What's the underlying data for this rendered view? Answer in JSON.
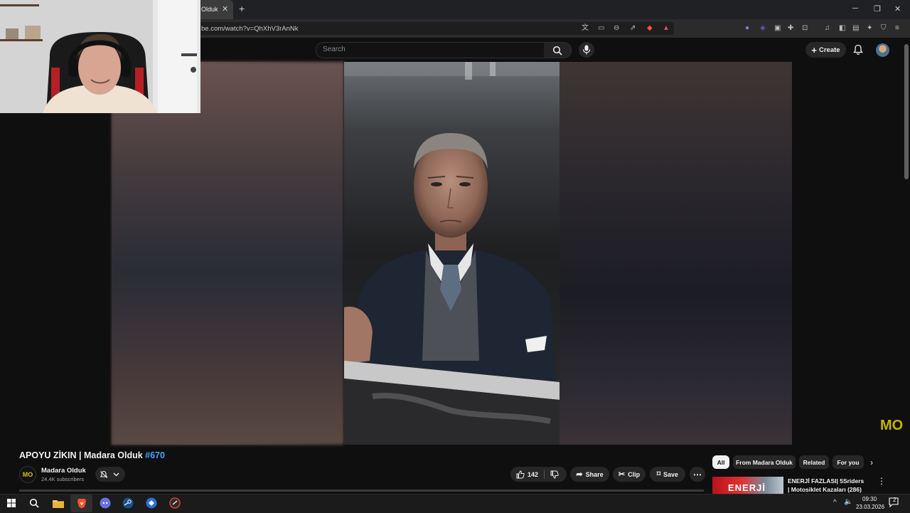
{
  "browser": {
    "tab_title": "Olduk",
    "tab_close": "✕",
    "new_tab": "+",
    "url": "be.com/watch?v=QhXhV3rAnNk"
  },
  "header": {
    "search_placeholder": "Search",
    "create_label": "Create"
  },
  "video": {
    "title": "APOYU ZİKIN | Madara Olduk",
    "hashtag": "#670",
    "watermark": "MO"
  },
  "channel": {
    "name": "Madara Olduk",
    "subscribers": "24.4K subscribers",
    "avatar_text": "MO"
  },
  "actions": {
    "likes": "142",
    "share": "Share",
    "clip": "Clip",
    "save": "Save"
  },
  "chips": [
    "All",
    "From Madara Olduk",
    "Related",
    "For you"
  ],
  "recommendation": {
    "title": "ENERJİ FAZLASI| 5Sriders | Motosiklet Kazaları (286)",
    "thumb_text": "ENERJİ"
  },
  "taskbar": {
    "time": "09:30",
    "date": "23.03.2026",
    "notification_count": "2"
  }
}
